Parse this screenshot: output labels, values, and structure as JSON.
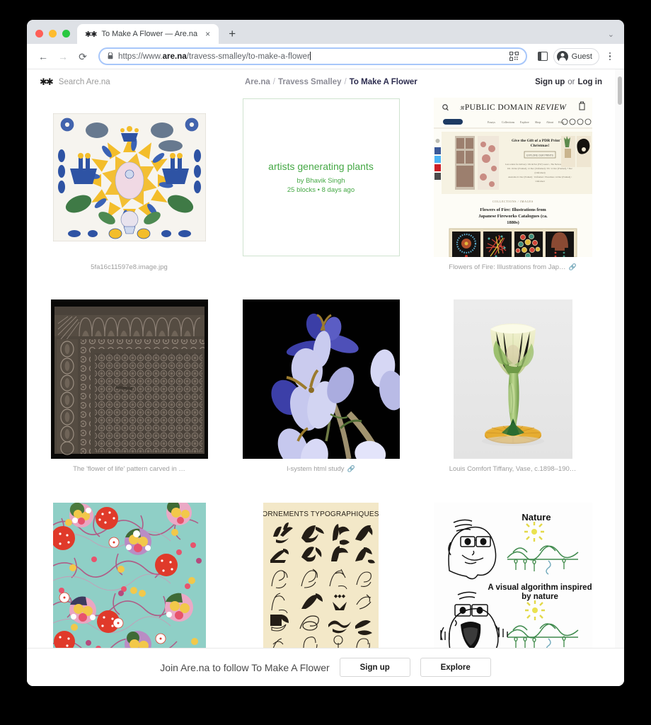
{
  "browser": {
    "traffic_lights": [
      "close",
      "minimize",
      "zoom"
    ],
    "tab": {
      "favicon": "arena-logo-icon",
      "title": "To Make A Flower — Are.na",
      "close_label": "×"
    },
    "new_tab_label": "+",
    "window_chevron": "⌄",
    "back_label": "←",
    "forward_label": "→",
    "reload_label": "⟳",
    "lock_label": "🔒",
    "url_prefix": "https://www.",
    "url_domain": "are.na",
    "url_path": "/travess-smalley/to-make-a-flower",
    "profile_label": "Guest",
    "kebab_label": "⋮"
  },
  "header": {
    "logo": "arena-asterisks-logo",
    "search_placeholder": "Search Are.na",
    "breadcrumb": {
      "root": "Are.na",
      "sep": "/",
      "user": "Travess Smalley",
      "current": "To Make A Flower"
    },
    "signup": "Sign up",
    "or": "or",
    "login": "Log in"
  },
  "blocks": [
    {
      "id": "shaker-gift-drawing",
      "kind": "image",
      "caption": "5fa16c11597e8.image.jpg",
      "has_link": false
    },
    {
      "id": "artists-generating-plants",
      "kind": "channel",
      "title": "artists generating plants",
      "author": "by Bhavik Singh",
      "meta": "25 blocks • 8 days ago",
      "accent": "#45a845",
      "caption": "",
      "has_link": false
    },
    {
      "id": "public-domain-review",
      "kind": "image",
      "caption": "Flowers of Fire: Illustrations from Jap…",
      "has_link": true,
      "site_title": "PUBLIC DOMAIN REVIEW",
      "site_banner": "Give the Gift of a PDR Print This Christmas!",
      "site_banner_button": "EXPLORE OUR PRINTS",
      "site_eyebrow": "COLLECTIONS / IMAGES",
      "site_headline": "Flowers of Fire: Illustrations from Japanese Fireworks Catalogues (ca. 1880s)",
      "site_nav": [
        "Essays",
        "Collections",
        "Explore",
        "Shop",
        "About",
        "Blog"
      ],
      "site_cta": "Support PDR"
    },
    {
      "id": "flower-of-life-carving",
      "kind": "image",
      "caption": "The 'flower of life' pattern carved in …",
      "has_link": false
    },
    {
      "id": "l-system-html-study",
      "kind": "image",
      "caption": "l-system html study",
      "has_link": true
    },
    {
      "id": "tiffany-vase",
      "kind": "image",
      "caption": "Louis Comfort Tiffany, Vase, c.1898–190…",
      "has_link": false
    },
    {
      "id": "floral-textile",
      "kind": "image",
      "caption": "",
      "has_link": false
    },
    {
      "id": "ornements-typographiques",
      "kind": "image",
      "caption": "",
      "has_link": false,
      "plate_title": "ORNEMENTS TYPOGRAPHIQUES"
    },
    {
      "id": "nature-algorithm-meme",
      "kind": "image",
      "caption": "",
      "has_link": false,
      "meme_top": "Nature",
      "meme_bottom": "A visual algorithm inspired by nature"
    }
  ],
  "cta": {
    "text": "Join Are.na to follow To Make A Flower",
    "signup": "Sign up",
    "explore": "Explore"
  }
}
